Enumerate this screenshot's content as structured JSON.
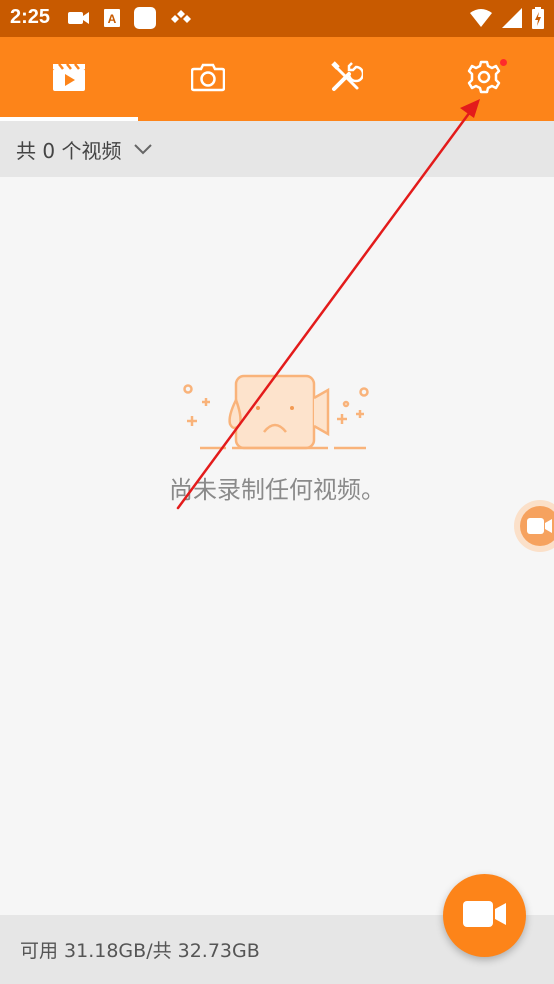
{
  "status_bar": {
    "time": "2:25"
  },
  "tabs": [
    {
      "name": "videos",
      "icon": "video-clapper-icon",
      "active": true
    },
    {
      "name": "screenshots",
      "icon": "camera-icon",
      "active": false
    },
    {
      "name": "tools",
      "icon": "tools-icon",
      "active": false
    },
    {
      "name": "settings",
      "icon": "gear-icon",
      "active": false,
      "badge": true
    }
  ],
  "filter": {
    "label": "共 0 个视频"
  },
  "empty_state": {
    "message": "尚未录制任何视频。"
  },
  "storage": {
    "text": "可用 31.18GB/共 32.73GB"
  },
  "colors": {
    "status_bar": "#c85a00",
    "accent": "#fd8419",
    "badge": "#ff2b2b",
    "annotation_arrow": "#e31b1b"
  }
}
